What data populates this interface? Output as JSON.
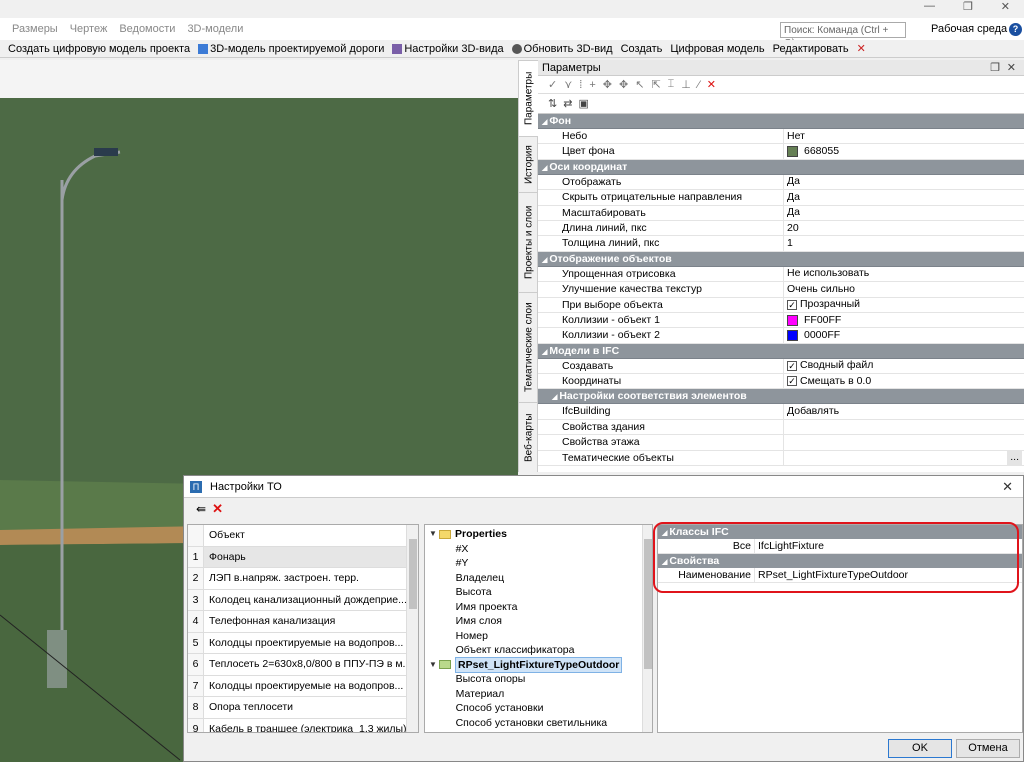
{
  "menu": {
    "items": [
      "Размеры",
      "Чертеж",
      "Ведомости",
      "3D-модели"
    ],
    "search_placeholder": "Поиск: Команда (Ctrl + Q)",
    "workspace": "Рабочая среда",
    "help_icon": "?"
  },
  "window_controls": {
    "min": "—",
    "restore": "❐",
    "close": "✕"
  },
  "toolbar": {
    "items": [
      "Создать цифровую модель проекта",
      "3D-модель проектируемой дороги",
      "Настройки 3D-вида",
      "Обновить 3D-вид",
      "Создать",
      "Цифровая модель",
      "Редактировать"
    ]
  },
  "side_tabs": [
    "Параметры",
    "История",
    "Проекты и слои",
    "Тематические слои",
    "Веб-карты"
  ],
  "params": {
    "title": "Параметры",
    "sections": [
      {
        "title": "Фон",
        "rows": [
          {
            "k": "Небо",
            "v": "Нет"
          },
          {
            "k": "Цвет фона",
            "v": "668055",
            "swatch": "#668055"
          }
        ]
      },
      {
        "title": "Оси координат",
        "rows": [
          {
            "k": "Отображать",
            "v": "Да"
          },
          {
            "k": "Скрыть отрицательные направления",
            "v": "Да"
          },
          {
            "k": "Масштабировать",
            "v": "Да"
          },
          {
            "k": "Длина линий, пкс",
            "v": "20"
          },
          {
            "k": "Толщина линий, пкс",
            "v": "1"
          }
        ]
      },
      {
        "title": "Отображение объектов",
        "rows": [
          {
            "k": "Упрощенная отрисовка",
            "v": "Не использовать"
          },
          {
            "k": "Улучшение качества текстур",
            "v": "Очень сильно"
          },
          {
            "k": "При выборе объекта",
            "v": "Прозрачный",
            "check": true
          },
          {
            "k": "Коллизии - объект 1",
            "v": "FF00FF",
            "swatch": "#FF00FF"
          },
          {
            "k": "Коллизии - объект 2",
            "v": "0000FF",
            "swatch": "#0000FF"
          }
        ]
      },
      {
        "title": "Модели в IFC",
        "rows": [
          {
            "k": "Создавать",
            "v": "Сводный файл",
            "check": true
          },
          {
            "k": "Координаты",
            "v": "Смещать в 0.0",
            "check": true
          }
        ]
      },
      {
        "title": "Настройки соответствия элементов",
        "sub": true,
        "rows": [
          {
            "k": "IfcBuilding",
            "v": "Добавлять"
          },
          {
            "k": "Свойства здания",
            "v": ""
          },
          {
            "k": "Свойства этажа",
            "v": ""
          },
          {
            "k": "Тематические объекты",
            "v": "..."
          }
        ]
      }
    ]
  },
  "dialog": {
    "title": "Настройки ТО",
    "logo": "П",
    "list_header": "Объект",
    "objects": [
      "Фонарь",
      "ЛЭП в.напряж. застроен. терр.",
      "Колодец канализационный дождеприе...",
      "Телефонная канализация",
      "Колодцы проектируемые на водопров...",
      "Теплосеть 2=630x8,0/800 в ППУ-ПЭ в м...",
      "Колодцы проектируемые на водопров...",
      "Опора теплосети",
      "Кабель в траншее (электрика_1,3 жилы)"
    ],
    "tree": {
      "root": "Properties",
      "root_items": [
        "#X",
        "#Y",
        "Владелец",
        "Высота",
        "Имя проекта",
        "Имя слоя",
        "Номер",
        "Объект классификатора"
      ],
      "pset": "RPset_LightFixtureTypeOutdoor",
      "pset_items": [
        "Высота опоры",
        "Материал",
        "Способ установки",
        "Способ установки светильника"
      ]
    },
    "right": {
      "sections": [
        {
          "title": "Классы IFC",
          "rows": [
            {
              "k": "Все",
              "v": "IfcLightFixture"
            }
          ]
        },
        {
          "title": "Свойства",
          "rows": [
            {
              "k": "Наименование",
              "v": "RPset_LightFixtureTypeOutdoor"
            }
          ]
        }
      ]
    },
    "ok": "OK",
    "cancel": "Отмена"
  }
}
